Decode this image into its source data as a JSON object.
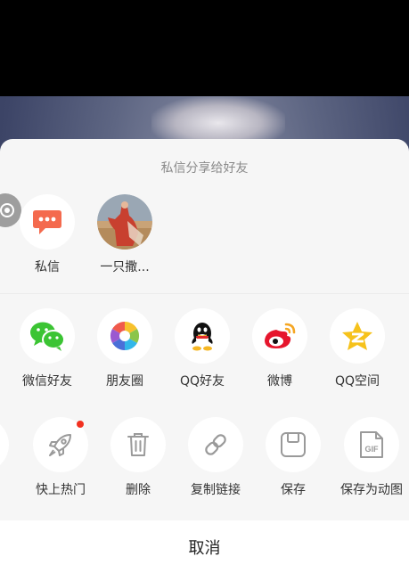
{
  "share_sheet": {
    "title": "私信分享给好友",
    "friends": [
      {
        "label": "私信",
        "icon": "chat-bubble-icon"
      },
      {
        "label": "一只撒...",
        "icon": "avatar"
      }
    ],
    "platforms": [
      {
        "label": "微信好友",
        "icon": "wechat-icon",
        "color": "#3bc433"
      },
      {
        "label": "朋友圈",
        "icon": "moments-icon"
      },
      {
        "label": "QQ好友",
        "icon": "qq-icon"
      },
      {
        "label": "微博",
        "icon": "weibo-icon",
        "color": "#e6162d"
      },
      {
        "label": "QQ空间",
        "icon": "qzone-icon",
        "color": "#f6c21b"
      }
    ],
    "actions": [
      {
        "label": "快上热门",
        "icon": "rocket-icon",
        "badge": true
      },
      {
        "label": "删除",
        "icon": "trash-icon"
      },
      {
        "label": "复制链接",
        "icon": "link-icon"
      },
      {
        "label": "保存",
        "icon": "save-icon"
      },
      {
        "label": "保存为动图",
        "icon": "gif-icon",
        "icon_text": "GIF"
      }
    ],
    "cancel_label": "取消"
  },
  "colors": {
    "private_message_accent": "#f46a4e",
    "badge_red": "#f2301f"
  }
}
